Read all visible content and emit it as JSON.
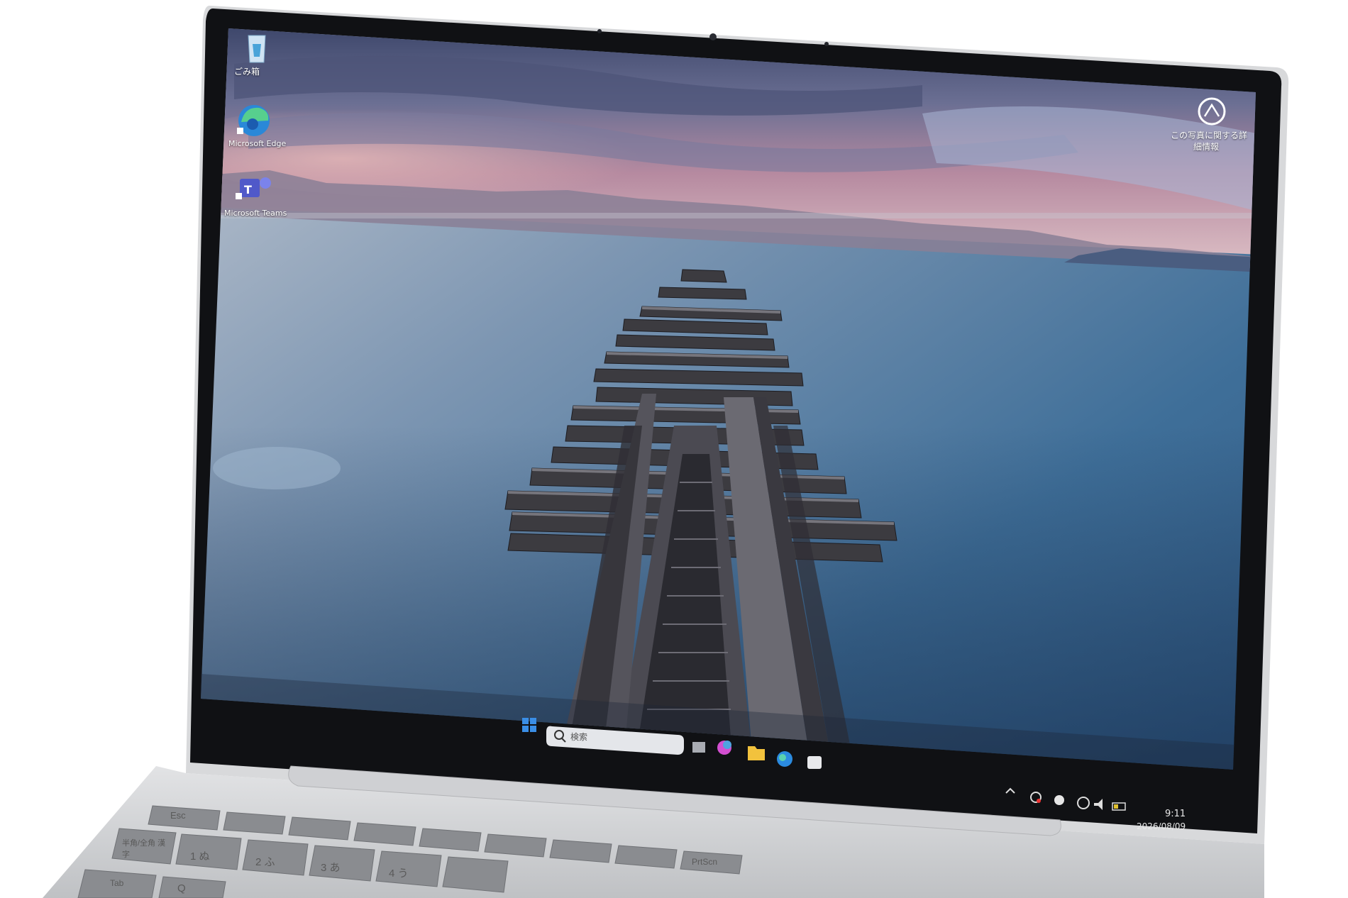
{
  "desktop": {
    "icons": [
      {
        "label": "ごみ箱",
        "icon": "recycle-bin-icon"
      },
      {
        "label": "Microsoft Edge",
        "icon": "edge-icon"
      },
      {
        "label": "Microsoft Teams",
        "icon": "teams-icon"
      }
    ],
    "spotlight": {
      "label_line1": "この写真に関する詳",
      "label_line2": "細情報",
      "icon": "camera-info-icon"
    }
  },
  "taskbar": {
    "search_placeholder": "検索",
    "clock": {
      "time": "9:11",
      "date": "2026/08/09"
    }
  },
  "keyboard": {
    "keys": [
      "Esc",
      "半角/全角 漢字",
      "Tab",
      "1 ぬ",
      "2 ふ",
      "3 あ",
      "4 う",
      "Q",
      "PrtScn"
    ]
  },
  "colors": {
    "bezel": "#101114",
    "chassis": "#c9cacc",
    "sky_top": "#3e4a6e",
    "water": "#3e6e98"
  }
}
